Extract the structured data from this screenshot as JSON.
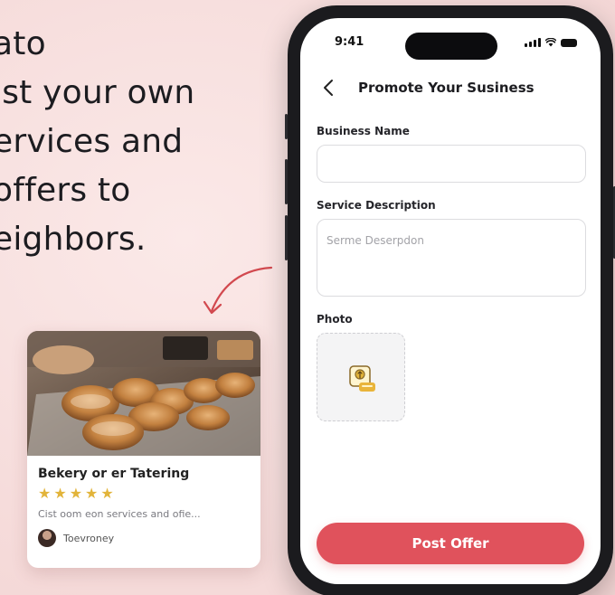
{
  "headline": {
    "lines": [
      "ato",
      "ist your own",
      "ervices and",
      "offers to",
      "eighbors."
    ]
  },
  "card": {
    "title": "Bekery or er Tatering",
    "rating": 5,
    "stars": [
      "★",
      "★",
      "★",
      "★",
      "★"
    ],
    "description": "Cist oom eon services and ofie...",
    "author": "Toevroney"
  },
  "phone": {
    "status": {
      "time": "9:41"
    },
    "nav": {
      "title": "Promote Your Susiness",
      "back_icon": "chevron-left-icon"
    },
    "form": {
      "business_name_label": "Business Name",
      "business_name_value": "",
      "description_label": "Service Description",
      "description_placeholder": "Serme Deserpdon",
      "photo_label": "Photo",
      "photo_icon": "image-upload-icon"
    },
    "post_button": "Post Offer"
  },
  "colors": {
    "accent": "#e0525c",
    "star": "#e2b43a",
    "background": "#f6dcdb"
  }
}
